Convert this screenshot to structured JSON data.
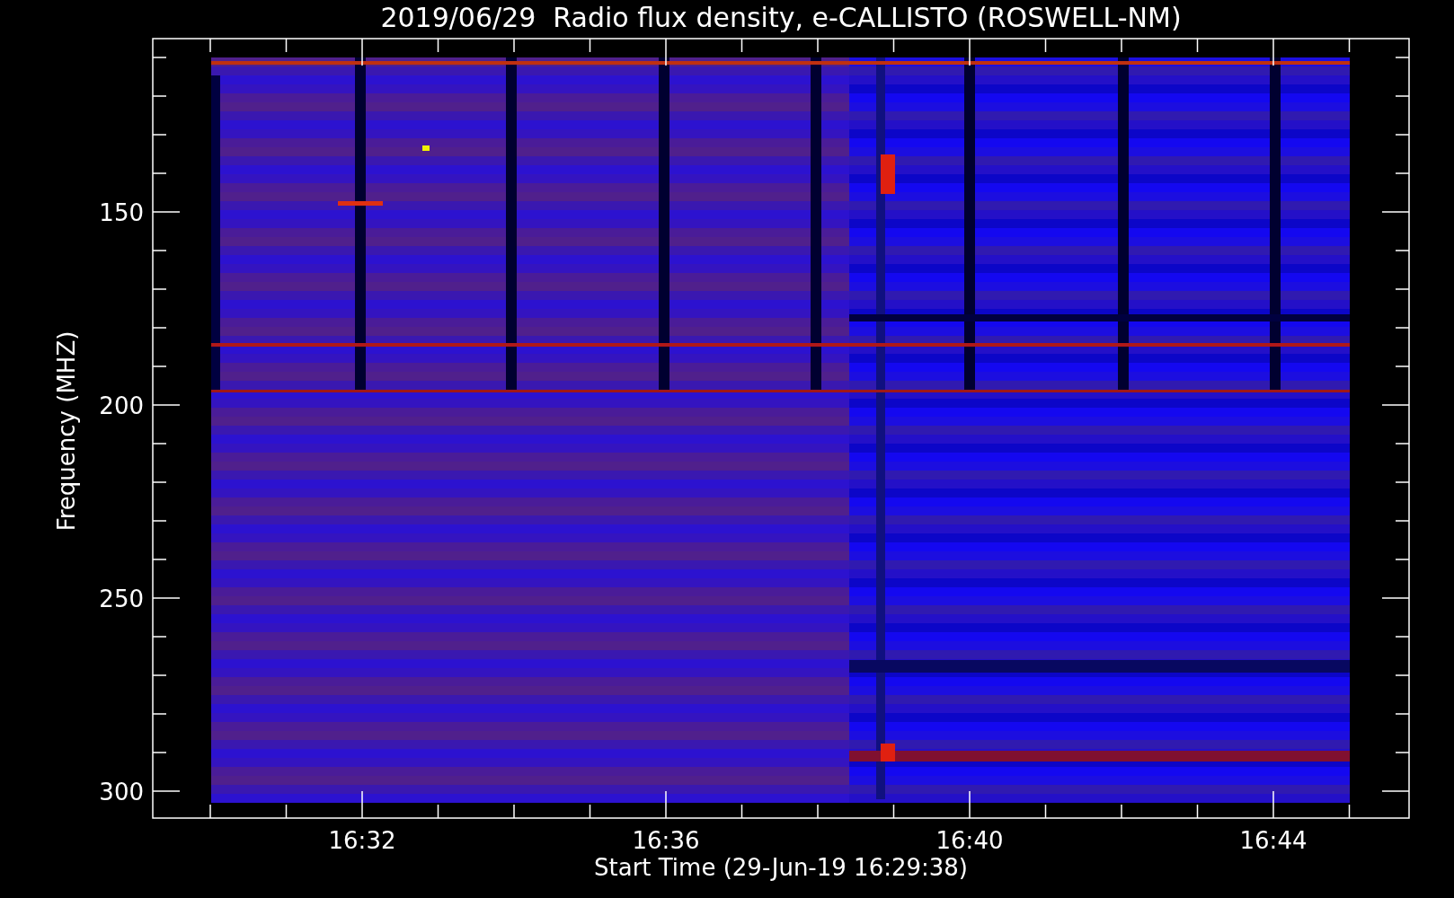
{
  "title": "2019/06/29  Radio flux density, e-CALLISTO (ROSWELL-NM)",
  "y_axis": {
    "label": "Frequency (MHZ)",
    "ticks": [
      "150",
      "200",
      "250",
      "300"
    ]
  },
  "x_axis": {
    "label": "Start Time (29-Jun-19 16:29:38)",
    "ticks": [
      "16:32",
      "16:36",
      "16:40",
      "16:44"
    ]
  }
}
